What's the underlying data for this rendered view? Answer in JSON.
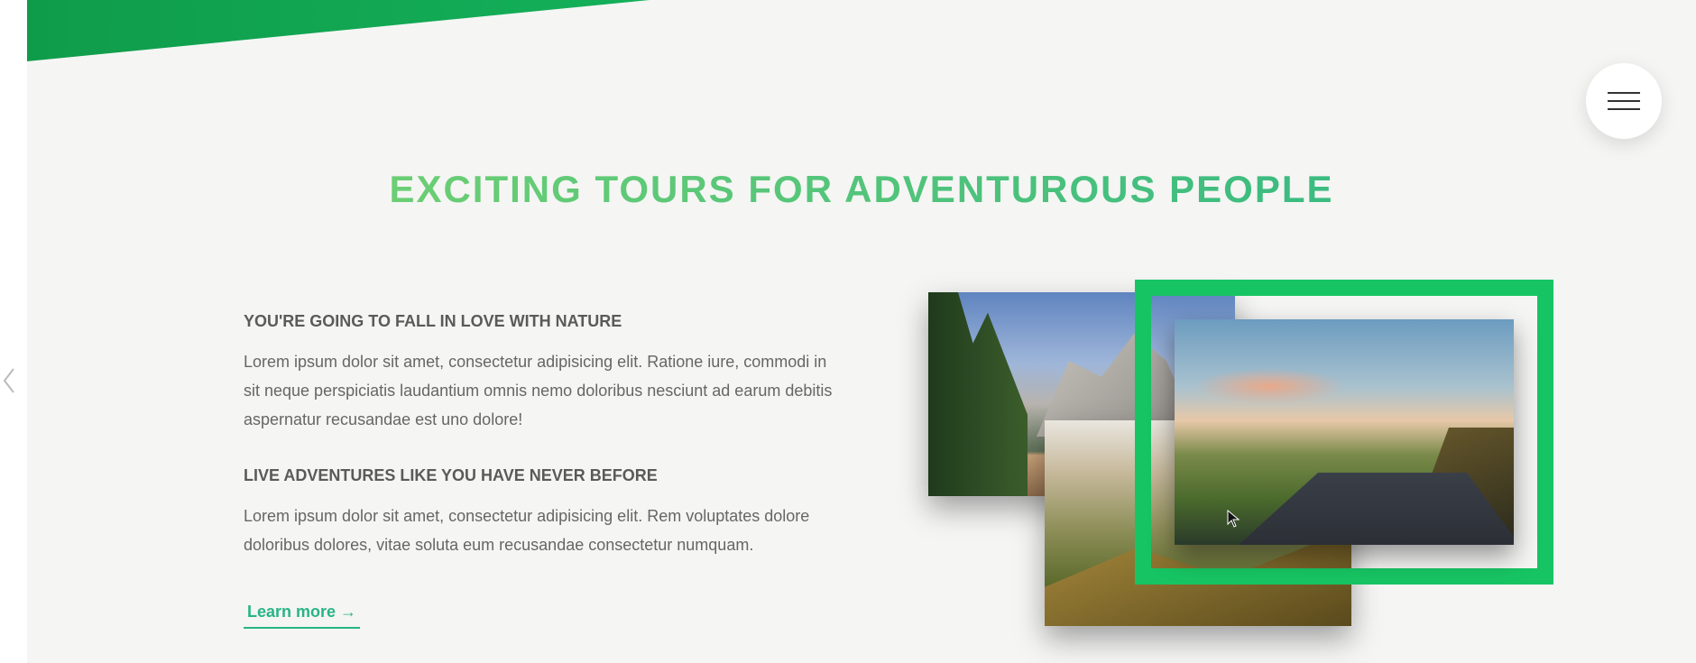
{
  "nav": {
    "menu_icon": "hamburger-icon",
    "back_icon": "chevron-left-icon"
  },
  "section": {
    "title": "EXCITING TOURS FOR ADVENTUROUS PEOPLE",
    "blocks": [
      {
        "heading": "YOU'RE GOING TO FALL IN LOVE WITH NATURE",
        "text": "Lorem ipsum dolor sit amet, consectetur adipisicing elit. Ratione iure, commodi in sit neque perspiciatis laudantium omnis nemo doloribus nesciunt ad earum debitis aspernatur recusandae est uno dolore!"
      },
      {
        "heading": "LIVE ADVENTURES LIKE YOU HAVE NEVER BEFORE",
        "text": "Lorem ipsum dolor sit amet, consectetur adipisicing elit. Rem voluptates dolore doloribus dolores, vitae soluta eum recusandae consectetur numquam."
      }
    ],
    "link": "Learn more →"
  },
  "colors": {
    "accent": "#28b485",
    "accent_light": "#7ed56f",
    "frame": "#17c463",
    "background": "#f5f5f4"
  }
}
